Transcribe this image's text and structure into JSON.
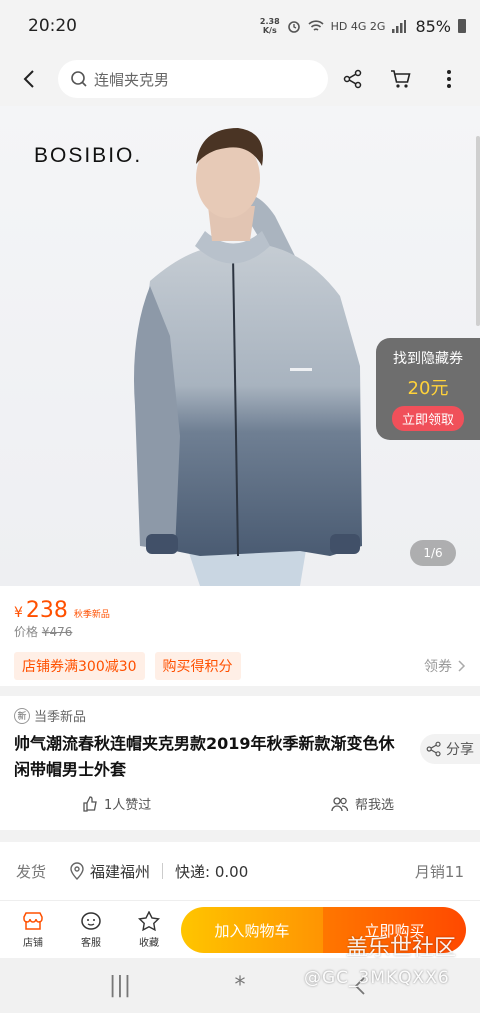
{
  "status_bar": {
    "time": "20:20",
    "speed_top": "2.38",
    "speed_bottom": "K/s",
    "network": "HD 4G 2G",
    "battery": "85%"
  },
  "nav": {
    "search_placeholder": "连帽夹克男",
    "icons": [
      "back-arrow-icon",
      "search-icon",
      "share-icon",
      "cart-icon",
      "more-icon"
    ]
  },
  "hero": {
    "brand": "BOSIBIO.",
    "coupon": {
      "title": "找到隐藏券",
      "amount": "20元",
      "button": "立即领取"
    },
    "page_indicator": "1/6"
  },
  "price": {
    "symbol": "¥",
    "amount": "238",
    "tag": "秋季新品",
    "orig_label": "价格",
    "orig_symbol": "¥",
    "orig_amount": "476"
  },
  "promos": {
    "tags": [
      "店铺券满300减30",
      "购买得积分"
    ],
    "coupon_link": "领券"
  },
  "product": {
    "season_badge": "新",
    "season_label": "当季新品",
    "title": "帅气潮流春秋连帽夹克男款2019年秋季新款渐变色休闲带帽男士外套",
    "share": "分享",
    "likes": "1人赞过",
    "help": "帮我选"
  },
  "shipping": {
    "label": "发货",
    "location": "福建福州",
    "express": "快递: 0.00",
    "sales": "月销11"
  },
  "bottom_bar": {
    "shop": "店铺",
    "service": "客服",
    "favorite": "收藏",
    "add_cart": "加入购物车",
    "buy_now": "立即购买"
  },
  "system_nav": {
    "recent": "|||",
    "home": "*"
  },
  "watermark": {
    "line1": "盖乐世社区",
    "line2": "@GC_3MKQXX6"
  },
  "colors": {
    "accent": "#ff5000",
    "cart_btn": "#ffb300",
    "buy_btn": "#ff5a00"
  }
}
